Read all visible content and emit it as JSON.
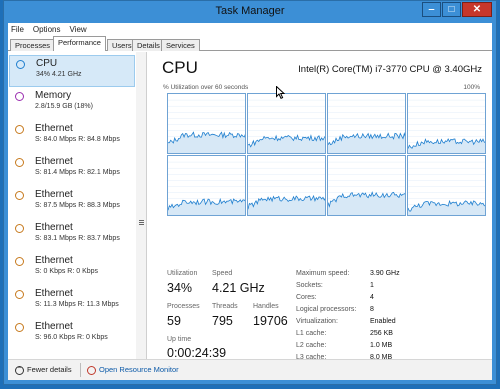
{
  "window": {
    "title": "Task Manager",
    "controls": {
      "minimize": "‒",
      "maximize": "□",
      "close": "✕"
    }
  },
  "menu": [
    "File",
    "Options",
    "View"
  ],
  "tabs": [
    "Processes",
    "Performance",
    "Users",
    "Details",
    "Services"
  ],
  "active_tab": "Performance",
  "resources": [
    {
      "name": "CPU",
      "detail": "34%  4.21 GHz",
      "color": "#1f7fcf",
      "selected": true
    },
    {
      "name": "Memory",
      "detail": "2.8/15.9 GB (18%)",
      "color": "#9b2fb0",
      "selected": false
    },
    {
      "name": "Ethernet",
      "detail": "S: 84.0 Mbps  R: 84.8 Mbps",
      "color": "#c77a1e",
      "selected": false
    },
    {
      "name": "Ethernet",
      "detail": "S: 81.4 Mbps  R: 82.1 Mbps",
      "color": "#c77a1e",
      "selected": false
    },
    {
      "name": "Ethernet",
      "detail": "S: 87.5 Mbps  R: 88.3 Mbps",
      "color": "#c77a1e",
      "selected": false
    },
    {
      "name": "Ethernet",
      "detail": "S: 83.1 Mbps  R: 83.7 Mbps",
      "color": "#c77a1e",
      "selected": false
    },
    {
      "name": "Ethernet",
      "detail": "S: 0 Kbps  R: 0 Kbps",
      "color": "#c77a1e",
      "selected": false
    },
    {
      "name": "Ethernet",
      "detail": "S: 11.3 Mbps  R: 11.3 Mbps",
      "color": "#c77a1e",
      "selected": false
    },
    {
      "name": "Ethernet",
      "detail": "S: 96.0 Kbps  R: 0 Kbps",
      "color": "#c77a1e",
      "selected": false
    }
  ],
  "cpu": {
    "heading": "CPU",
    "model": "Intel(R) Core(TM) i7-3770 CPU @ 3.40GHz",
    "graph_caption": "% Utilization over 60 seconds",
    "graph_max": "100%",
    "graph_color": "#1f7fcf",
    "graph_fill": "#d7e8f6",
    "graph_bg_grid": "#e3eef8",
    "core_levels": [
      0.33,
      0.28,
      0.31,
      0.22,
      0.25,
      0.3,
      0.36,
      0.22
    ]
  },
  "stats": {
    "utilization_label": "Utilization",
    "utilization": "34%",
    "speed_label": "Speed",
    "speed": "4.21 GHz",
    "processes_label": "Processes",
    "processes": "59",
    "threads_label": "Threads",
    "threads": "795",
    "handles_label": "Handles",
    "handles": "19706",
    "uptime_label": "Up time",
    "uptime": "0:00:24:39"
  },
  "specs": [
    {
      "key": "Maximum speed:",
      "value": "3.90 GHz"
    },
    {
      "key": "Sockets:",
      "value": "1"
    },
    {
      "key": "Cores:",
      "value": "4"
    },
    {
      "key": "Logical processors:",
      "value": "8"
    },
    {
      "key": "Virtualization:",
      "value": "Enabled"
    },
    {
      "key": "L1 cache:",
      "value": "256 KB"
    },
    {
      "key": "L2 cache:",
      "value": "1.0 MB"
    },
    {
      "key": "L3 cache:",
      "value": "8.0 MB"
    }
  ],
  "footer": {
    "fewer_details": "Fewer details",
    "open_resource_monitor": "Open Resource Monitor"
  }
}
